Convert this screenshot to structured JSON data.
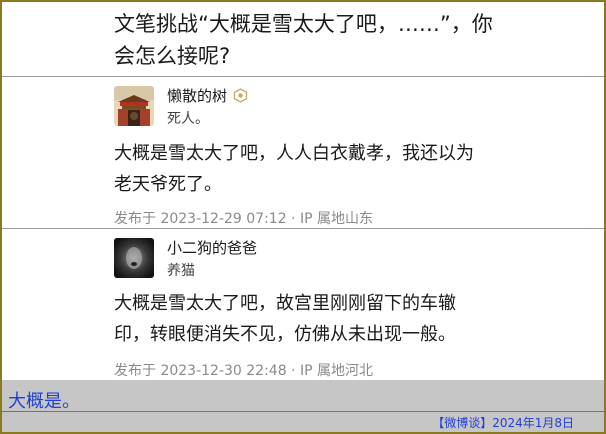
{
  "question": {
    "line1": "文笔挑战“大概是雪太大了吧，……”，你",
    "line2": "会怎么接呢?"
  },
  "answers": [
    {
      "author": "懒散的树",
      "bio": "死人。",
      "avatar_icon": "forbidden-city-avatar",
      "badge_icon": "hexagon-badge-icon",
      "content_line1": "大概是雪太大了吧，人人白衣戴孝，我还以为",
      "content_line2": "老天爷死了。",
      "meta": "发布于 2023-12-29 07:12 · IP 属地山东"
    },
    {
      "author": "小二狗的爸爸",
      "bio": "养猫",
      "avatar_icon": "dark-face-avatar",
      "content_line1": "大概是雪太大了吧，故宫里刚刚留下的车辙",
      "content_line2": "印，转眼便消失不见，仿佛从未出现一般。",
      "meta": "发布于 2023-12-30 22:48 · IP 属地河北"
    }
  ],
  "footer": {
    "comment": "大概是。",
    "credit": "【微博谈】2024年1月8日"
  },
  "colors": {
    "border": "#8a7a1e",
    "comment_text": "#1f3fd6",
    "footer_bg": "#c6c6c6"
  }
}
